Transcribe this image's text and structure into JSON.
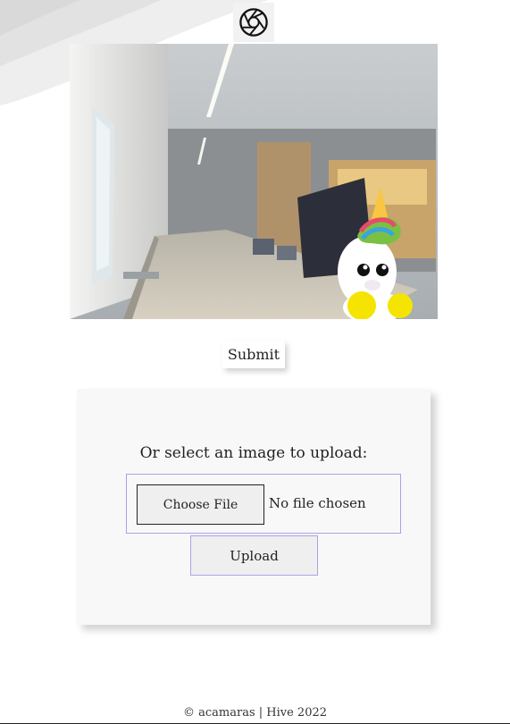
{
  "camera": {
    "shutter_icon": "camera-shutter-icon",
    "overlay_sticker": "unicorn-sticker"
  },
  "actions": {
    "submit_label": "Submit"
  },
  "upload": {
    "prompt": "Or select an image to upload:",
    "choose_label": "Choose File",
    "file_status": "No file chosen",
    "upload_label": "Upload"
  },
  "footer": {
    "text": "© acamaras | Hive 2022"
  }
}
